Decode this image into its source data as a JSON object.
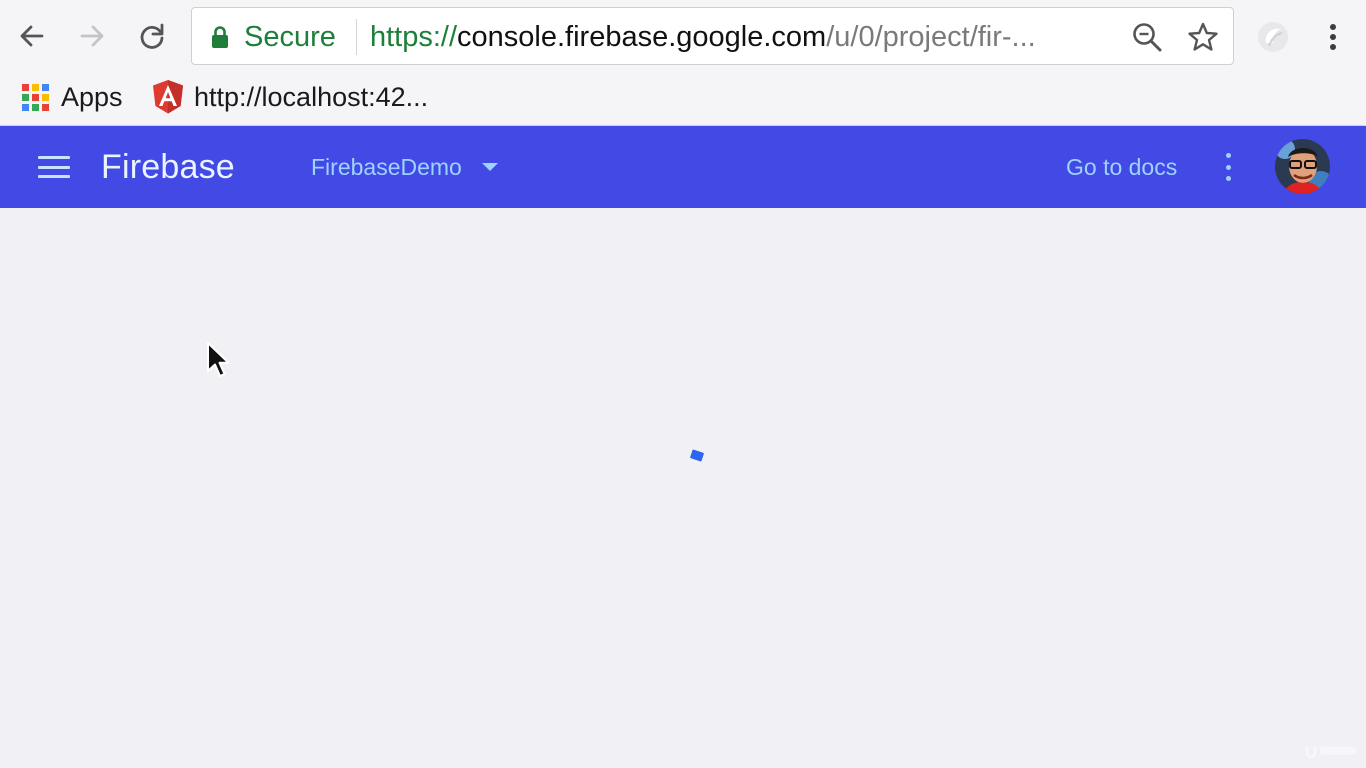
{
  "browser": {
    "secure_label": "Secure",
    "url_scheme": "https://",
    "url_host": "console.firebase.google.com",
    "url_path": "/u/0/project/fir-...",
    "icons": [
      "back-arrow-icon",
      "forward-arrow-icon",
      "reload-icon",
      "lock-icon",
      "zoom-icon",
      "bookmark-star-icon",
      "extension-icon",
      "chrome-menu-icon"
    ]
  },
  "bookmarks": {
    "apps_label": "Apps",
    "localhost_label": "http://localhost:42..."
  },
  "header": {
    "brand": "Firebase",
    "project_name": "FirebaseDemo",
    "docs_label": "Go to docs"
  },
  "colors": {
    "header_bg": "#4249e4",
    "header_link": "#9fd3ff",
    "secure_green": "#1e7f3b",
    "spinner": "#2d64f0",
    "page_bg": "#f1f0f5"
  }
}
